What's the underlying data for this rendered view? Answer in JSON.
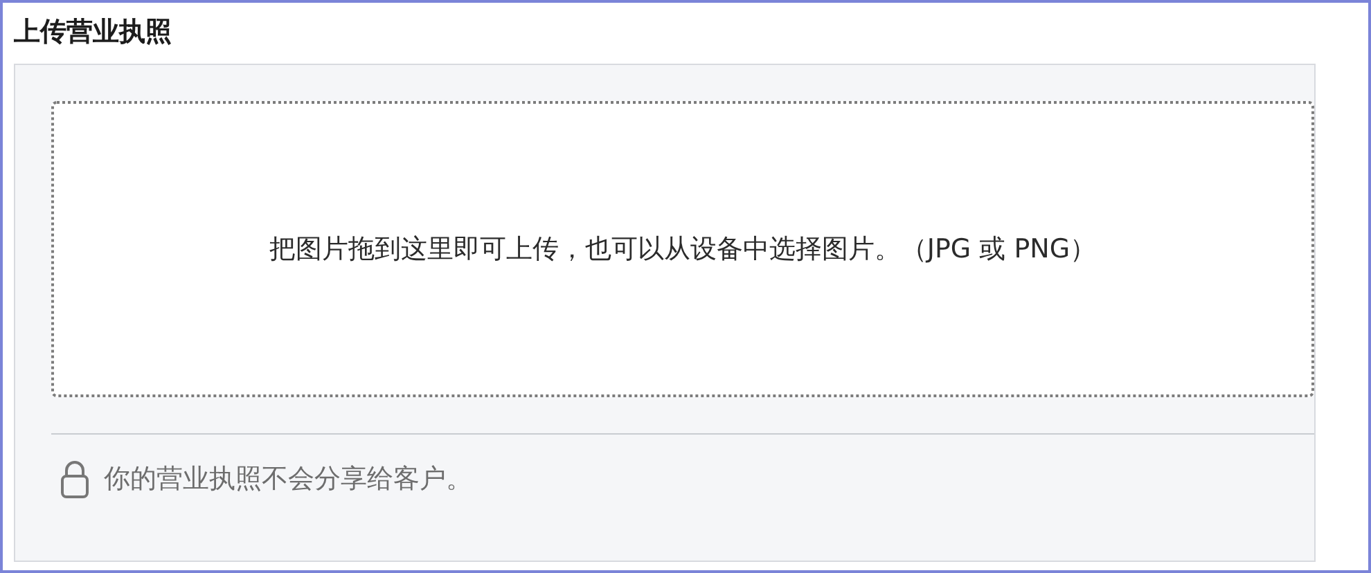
{
  "title": "上传营业执照",
  "dropzone": {
    "text": "把图片拖到这里即可上传，也可以从设备中选择图片。（JPG 或 PNG）"
  },
  "note": {
    "text": "你的营业执照不会分享给客户。"
  }
}
